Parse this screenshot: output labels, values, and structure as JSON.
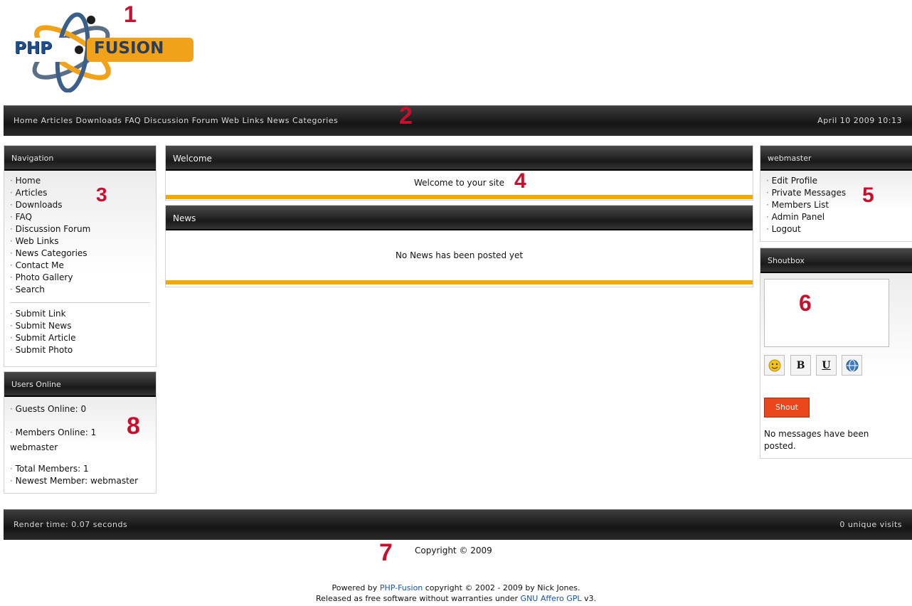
{
  "markers": [
    "1",
    "2",
    "3",
    "4",
    "5",
    "6",
    "7",
    "8"
  ],
  "logo": {
    "left": "PHP",
    "right": "FUSION"
  },
  "topbar": {
    "links_text": "Home  Articles  Downloads  FAQ  Discussion Forum  Web Links  News Categories",
    "date_text": "April 10 2009 10:13"
  },
  "nav": {
    "title": "Navigation",
    "items": [
      "Home",
      "Articles",
      "Downloads",
      "FAQ",
      "Discussion Forum",
      "Web Links",
      "News Categories",
      "Contact Me",
      "Photo Gallery",
      "Search"
    ],
    "submit_items": [
      "Submit Link",
      "Submit News",
      "Submit Article",
      "Submit Photo"
    ]
  },
  "users_online": {
    "title": "Users Online",
    "guests": "Guests Online: 0",
    "members": "Members Online: 1",
    "member_name": "webmaster",
    "total": "Total Members: 1",
    "newest": "Newest Member: webmaster"
  },
  "welcome": {
    "title": "Welcome",
    "text": "Welcome to your site"
  },
  "news": {
    "title": "News",
    "text": "No News has been posted yet"
  },
  "user_panel": {
    "title": "webmaster",
    "items": [
      "Edit Profile",
      "Private Messages",
      "Members List",
      "Admin Panel",
      "Logout"
    ]
  },
  "shoutbox": {
    "title": "Shoutbox",
    "tools": {
      "smiley": "smiley-icon",
      "bold": "B",
      "underline": "U",
      "link": "link-icon"
    },
    "button_label": "Shout",
    "empty_text": "No messages have been posted."
  },
  "footer_bar": {
    "left": "Render time: 0.07 seconds",
    "right": "0 unique visits"
  },
  "footer": {
    "copyright": "Copyright © 2009",
    "powered_prefix": "Powered by ",
    "powered_link": "PHP-Fusion",
    "powered_suffix": " copyright © 2002 - 2009 by Nick Jones.",
    "released_prefix": "Released as free software without warranties under ",
    "released_link": "GNU Affero GPL",
    "released_suffix": " v3."
  },
  "colors": {
    "accent": "#f2a900",
    "marker": "#c8102e",
    "link": "#1a55a0",
    "button": "#e8481c"
  }
}
